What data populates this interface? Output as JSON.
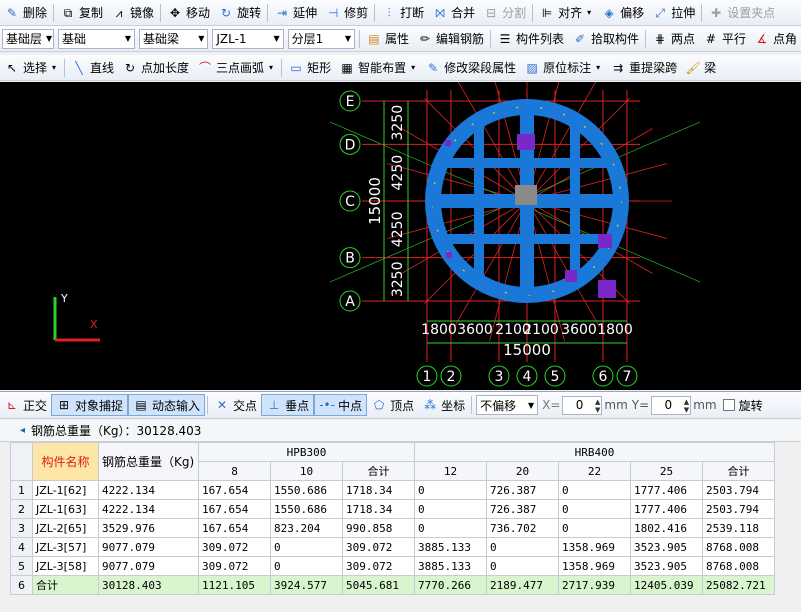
{
  "toolbar1": {
    "delete": "删除",
    "copy": "复制",
    "mirror": "镜像",
    "move": "移动",
    "rotate": "旋转",
    "extend": "延伸",
    "trim": "修剪",
    "break": "打断",
    "merge": "合并",
    "split": "分割",
    "align": "对齐",
    "offset": "偏移",
    "stretch": "拉伸",
    "set_grip": "设置夹点"
  },
  "toolbar2": {
    "layer": "基础层",
    "category": "基础",
    "type": "基础梁",
    "component": "JZL-1",
    "sublayer": "分层1",
    "properties": "属性",
    "edit_rebar": "编辑钢筋",
    "component_list": "构件列表",
    "pick": "拾取构件",
    "two_point": "两点",
    "parallel": "平行",
    "point_angle": "点角"
  },
  "toolbar3": {
    "select": "选择",
    "line": "直线",
    "point_length": "点加长度",
    "arc": "三点画弧",
    "rect": "矩形",
    "smart": "智能布置",
    "modify_seg": "修改梁段属性",
    "in_situ": "原位标注",
    "re_span": "重提梁跨",
    "beam": "梁"
  },
  "drawing": {
    "row_axes": [
      "E",
      "D",
      "C",
      "B",
      "A"
    ],
    "row_dims": [
      "3250",
      "4250",
      "4250",
      "3250"
    ],
    "row_total": "15000",
    "col_axes": [
      "1",
      "2",
      "3",
      "4",
      "5",
      "6",
      "7"
    ],
    "col_dims": [
      "1800",
      "3600",
      "2100",
      "2100",
      "3600",
      "1800"
    ],
    "col_total": "15000",
    "ucs_y": "Y",
    "ucs_x": "X",
    "colors": {
      "beam": "#1a78d8",
      "grid": "#e02020",
      "axis_green": "#2bd42b",
      "column": "#7a28c8"
    }
  },
  "snapbar": {
    "ortho": "正交",
    "object_snap": "对象捕捉",
    "dynamic_input": "动态输入",
    "intersection": "交点",
    "perpendicular": "垂点",
    "midpoint": "中点",
    "vertex": "顶点",
    "coord": "坐标",
    "offset_mode": "不偏移",
    "x_label": "X=",
    "x_value": "0",
    "y_label": "Y=",
    "y_value": "0",
    "unit": "mm",
    "rotate": "旋转"
  },
  "summary": {
    "label": "钢筋总重量（Kg）：",
    "value": "30128.403"
  },
  "table": {
    "col_name": "构件名称",
    "col_total": "钢筋总重量（Kg)",
    "group1": "HPB300",
    "group2": "HRB400",
    "g1_cols": [
      "8",
      "10",
      "合计"
    ],
    "g2_cols": [
      "12",
      "20",
      "22",
      "25",
      "合计"
    ],
    "rows": [
      {
        "idx": "1",
        "name": "JZL-1[62]",
        "total": "4222.134",
        "c8": "167.654",
        "c10": "1550.686",
        "s1": "1718.34",
        "c12": "0",
        "c20": "726.387",
        "c22": "0",
        "c25": "1777.406",
        "s2": "2503.794"
      },
      {
        "idx": "2",
        "name": "JZL-1[63]",
        "total": "4222.134",
        "c8": "167.654",
        "c10": "1550.686",
        "s1": "1718.34",
        "c12": "0",
        "c20": "726.387",
        "c22": "0",
        "c25": "1777.406",
        "s2": "2503.794"
      },
      {
        "idx": "3",
        "name": "JZL-2[65]",
        "total": "3529.976",
        "c8": "167.654",
        "c10": "823.204",
        "s1": "990.858",
        "c12": "0",
        "c20": "736.702",
        "c22": "0",
        "c25": "1802.416",
        "s2": "2539.118"
      },
      {
        "idx": "4",
        "name": "JZL-3[57]",
        "total": "9077.079",
        "c8": "309.072",
        "c10": "0",
        "s1": "309.072",
        "c12": "3885.133",
        "c20": "0",
        "c22": "1358.969",
        "c25": "3523.905",
        "s2": "8768.008"
      },
      {
        "idx": "5",
        "name": "JZL-3[58]",
        "total": "9077.079",
        "c8": "309.072",
        "c10": "0",
        "s1": "309.072",
        "c12": "3885.133",
        "c20": "0",
        "c22": "1358.969",
        "c25": "3523.905",
        "s2": "8768.008"
      },
      {
        "idx": "6",
        "name": "合计",
        "total": "30128.403",
        "c8": "1121.105",
        "c10": "3924.577",
        "s1": "5045.681",
        "c12": "7770.266",
        "c20": "2189.477",
        "c22": "2717.939",
        "c25": "12405.039",
        "s2": "25082.721"
      }
    ]
  }
}
